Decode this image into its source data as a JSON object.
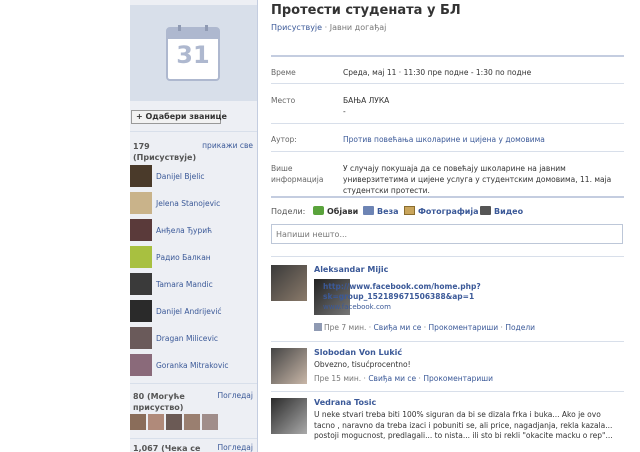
{
  "sidebar": {
    "calendar_number": "31",
    "choose_button": "+ Одабери званице",
    "attending": {
      "count_label": "179\n(Присуствује)",
      "count": "179",
      "label": "(Присуствује)",
      "see_all": "прикажи све",
      "people": [
        {
          "name": "Danijel Bjelic"
        },
        {
          "name": "Jelena Stanojevic"
        },
        {
          "name": "Анђела Ђурић"
        },
        {
          "name": "Радио Балкан"
        },
        {
          "name": "Tamara Mandic"
        },
        {
          "name": "Danijel Andrijević"
        },
        {
          "name": "Dragan Milicevic"
        },
        {
          "name": "Goranka Mitrakovic"
        }
      ]
    },
    "maybe": {
      "count": "80",
      "label": "(Могуће",
      "label2": "присуство)",
      "link": "Погледај"
    },
    "awaiting": {
      "count": "1,067",
      "label": "(Чека се",
      "link": "Погледај"
    }
  },
  "event": {
    "title": "Протести студената у БЛ",
    "subtitle_link": "Присуствује",
    "subtitle_sep": " · ",
    "subtitle_type": "Јавни догађај",
    "info": [
      {
        "label": "Време",
        "value": "Среда, мај 11 · 11:30 пре подне - 1:30 по подне"
      },
      {
        "label": "Место",
        "value": "БАЊА ЛУКА",
        "value2": "-"
      },
      {
        "label": "Аутор:",
        "value": "Против повећања школарине и цијена у домовима"
      },
      {
        "label": "Више",
        "label2": "информација",
        "value": "У случају покушаја да се повећају школарине на јавним универзитетима и цијене услуга у студентским домовима, 11. маја студентски протести."
      }
    ]
  },
  "share": {
    "label": "Подели:",
    "items": [
      "Објави",
      "Веза",
      "Фотографија",
      "Видео"
    ],
    "placeholder": "Напиши нешто..."
  },
  "posts": [
    {
      "author": "Aleksandar Mijic",
      "link_line1": "http://www.facebook.com/home.php?",
      "link_line2": "sk=group_152189671506388&ap=1",
      "link_source": "www.facebook.com",
      "time": "Пре 7 мин.",
      "actions": [
        "Свиђа ми се",
        "Прокоментариши",
        "Подели"
      ]
    },
    {
      "author": "Slobodan Von Lukić",
      "text": "Obvezno, tisućprocentno!",
      "time": "Пре 15 мин.",
      "actions": [
        "Свиђа ми се",
        "Прокоментариши"
      ]
    },
    {
      "author": "Vedrana Tosic",
      "text": "U neke stvari treba biti 100% siguran da bi se dizala frka i buka... Ako je ovo tacno , naravno da treba izaci i pobuniti se, ali price, nagadjanja, rekla kazala... postoji mogucnost, predlagali... to nista... ili sto bi rekli \"okacite macku o rep\"..."
    }
  ],
  "colors": {
    "link": "#3b5998",
    "sidebar_bg": "#edeff4",
    "border": "#d8dfea"
  }
}
